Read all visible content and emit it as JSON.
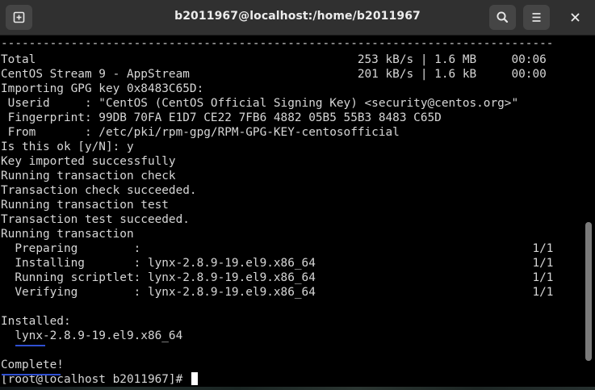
{
  "window": {
    "title": "b2011967@localhost:/home/b2011967"
  },
  "icons": {
    "new_tab": "new-tab-icon",
    "search": "search-icon",
    "menu": "hamburger-menu-icon",
    "close": "close-icon"
  },
  "colors": {
    "titlebar": "#303030",
    "terminal_bg": "#000000",
    "terminal_fg": "#d6d6d6",
    "highlight_underline": "#2f4fd1"
  },
  "terminal": {
    "lines": [
      "-------------------------------------------------------------------------------",
      "Total                                              253 kB/s | 1.6 MB     00:06",
      "CentOS Stream 9 - AppStream                        201 kB/s | 1.6 kB     00:00",
      "Importing GPG key 0x8483C65D:",
      " Userid     : \"CentOS (CentOS Official Signing Key) <security@centos.org>\"",
      " Fingerprint: 99DB 70FA E1D7 CE22 7FB6 4882 05B5 55B3 8483 C65D",
      " From       : /etc/pki/rpm-gpg/RPM-GPG-KEY-centosofficial",
      "Is this ok [y/N]: y",
      "Key imported successfully",
      "Running transaction check",
      "Transaction check succeeded.",
      "Running transaction test",
      "Transaction test succeeded.",
      "Running transaction",
      "  Preparing        :                                                        1/1",
      "  Installing       : lynx-2.8.9-19.el9.x86_64                               1/1",
      "  Running scriptlet: lynx-2.8.9-19.el9.x86_64                               1/1",
      "  Verifying        : lynx-2.8.9-19.el9.x86_64                               1/1",
      "",
      "Installed:",
      "  lynx-2.8.9-19.el9.x86_64",
      "",
      "Complete!"
    ],
    "prompt": "[root@localhost b2011967]# "
  }
}
